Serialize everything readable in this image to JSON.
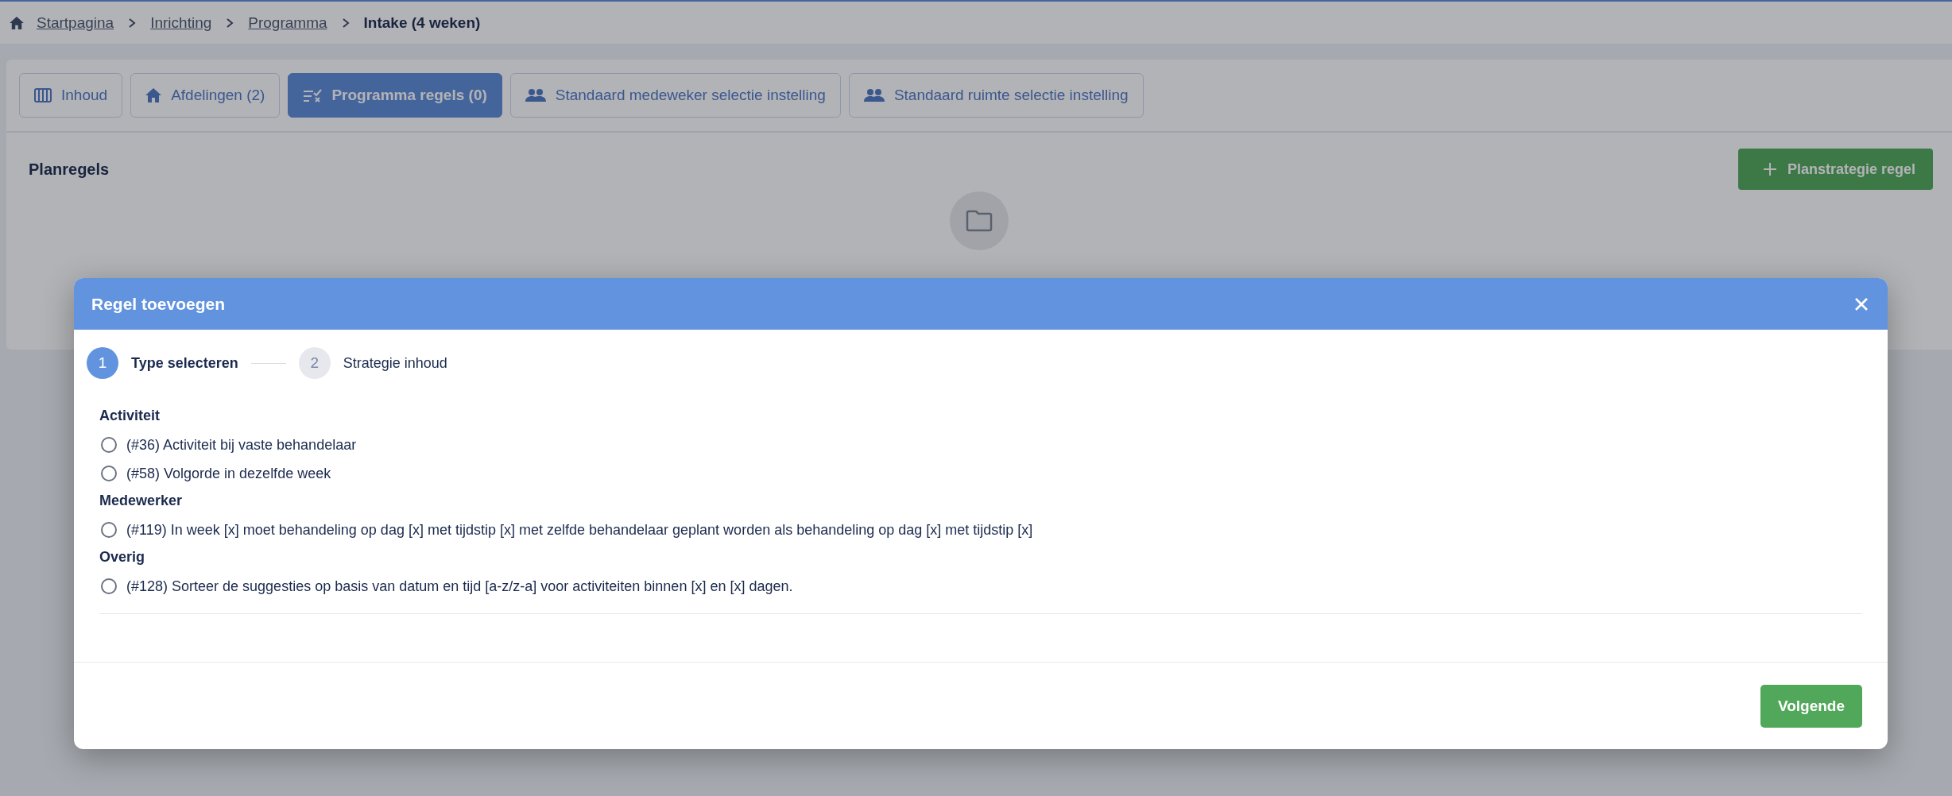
{
  "breadcrumbs": [
    {
      "label": "Startpagina",
      "kind": "link"
    },
    {
      "label": "Inrichting",
      "kind": "link"
    },
    {
      "label": "Programma",
      "kind": "link"
    },
    {
      "label": "Intake (4 weken)",
      "kind": "current"
    }
  ],
  "tabs": [
    {
      "label": "Inhoud",
      "kind": "columns",
      "selected": false
    },
    {
      "label": "Afdelingen (2)",
      "kind": "home",
      "selected": false
    },
    {
      "label": "Programma regels (0)",
      "kind": "rules",
      "selected": true
    },
    {
      "label": "Standaard medeweker selectie instelling",
      "kind": "people",
      "selected": false
    },
    {
      "label": "Standaard ruimte selectie instelling",
      "kind": "people",
      "selected": false
    }
  ],
  "section": {
    "title": "Planregels",
    "add_button": "Planstrategie regel"
  },
  "modal": {
    "title": "Regel toevoegen",
    "steps": [
      {
        "number": "1",
        "label": "Type selecteren",
        "selected": true
      },
      {
        "number": "2",
        "label": "Strategie inhoud",
        "selected": false
      }
    ],
    "groups": [
      {
        "title": "Activiteit",
        "options": [
          {
            "label": "(#36) Activiteit bij vaste behandelaar",
            "checked": false
          },
          {
            "label": "(#58) Volgorde in dezelfde week",
            "checked": false
          }
        ]
      },
      {
        "title": "Medewerker",
        "options": [
          {
            "label": "(#119) In week [x] moet behandeling op dag [x] met tijdstip [x] met zelfde behandelaar geplant worden als behandeling op dag [x] met tijdstip [x]",
            "checked": false
          }
        ]
      },
      {
        "title": "Overig",
        "options": [
          {
            "label": "(#128) Sorteer de suggesties op basis van datum en tijd [a-z/z-a] voor activiteiten binnen [x] en [x] dagen.",
            "checked": false
          }
        ]
      }
    ],
    "next_button": "Volgende"
  }
}
